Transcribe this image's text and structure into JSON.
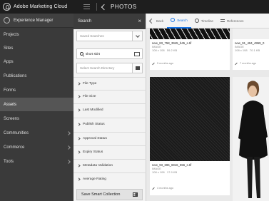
{
  "app": {
    "brand": "Adobe Marketing Cloud",
    "location": "PHOTOS"
  },
  "rail": {
    "header": "Experience Manager",
    "items": [
      {
        "label": "Projects",
        "has_children": false,
        "active": false
      },
      {
        "label": "Sites",
        "has_children": false,
        "active": false
      },
      {
        "label": "Apps",
        "has_children": false,
        "active": false
      },
      {
        "label": "Publications",
        "has_children": false,
        "active": false
      },
      {
        "label": "Forms",
        "has_children": false,
        "active": false
      },
      {
        "label": "Assets",
        "has_children": false,
        "active": true
      },
      {
        "label": "Screens",
        "has_children": false,
        "active": false
      },
      {
        "label": "Communities",
        "has_children": true,
        "active": false
      },
      {
        "label": "Commerce",
        "has_children": true,
        "active": false
      },
      {
        "label": "Tools",
        "has_children": true,
        "active": false
      }
    ]
  },
  "search": {
    "title": "Search",
    "close_icon": "close-icon",
    "saved_searches_placeholder": "Saved Searches",
    "query_value": "short skirt",
    "directory_placeholder": "Select Search Directory",
    "filters": [
      "File Type",
      "File Size",
      "Last Modified",
      "Publish Status",
      "Approval Status",
      "Expiry Status",
      "Metadata Validation",
      "Average Rating"
    ],
    "save_label": "Save Smart Collection"
  },
  "toolbar": {
    "back": "Back",
    "search": "Search",
    "timeline": "Timeline",
    "references": "References"
  },
  "results": [
    {
      "name": "new_83_758_3945_b45_s.tif",
      "type": "IMAGE",
      "dims": "108 x 108",
      "size": "59.2 KB",
      "modified": "5 months ago"
    },
    {
      "name": "new_91_494_4959_0",
      "type": "IMAGE",
      "dims": "108 x 108",
      "size": "70.1 KB",
      "modified": "7 months ago"
    },
    {
      "name": "new_93_696_6916_556_s.tif",
      "type": "IMAGE",
      "dims": "108 x 108",
      "size": "17.9 KB",
      "modified": "4 months ago"
    }
  ],
  "colors": {
    "accent": "#1473e6",
    "rail_bg": "#3a3a3a",
    "topbar_bg": "#1e1e1e"
  }
}
